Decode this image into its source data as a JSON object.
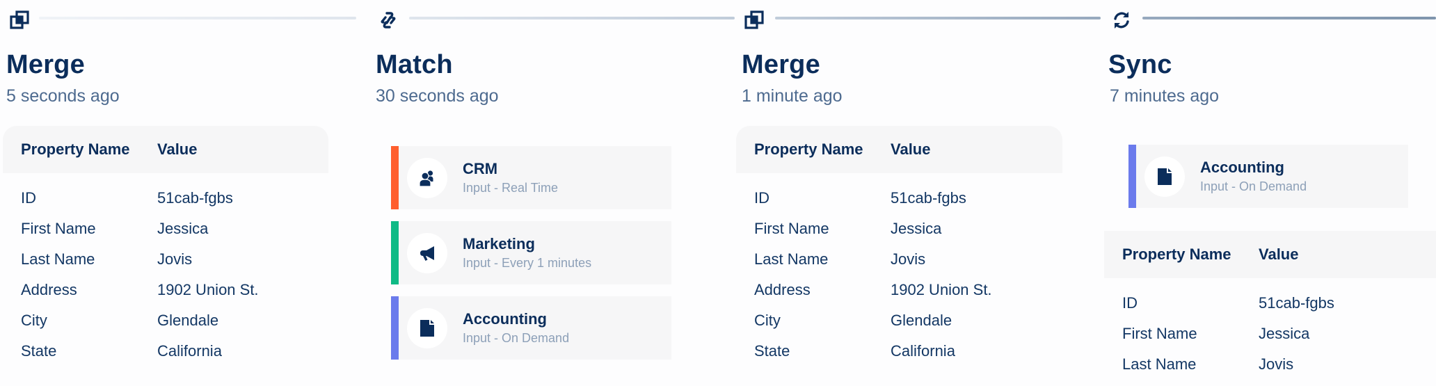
{
  "colors": {
    "primary": "#0b2d5b",
    "muted": "#4d6a8f",
    "crm": "#ff5f2e",
    "marketing": "#0fba85",
    "accounting": "#6b7bec"
  },
  "steps": [
    {
      "icon": "merge-icon",
      "title": "Merge",
      "time": "5 seconds ago",
      "table": {
        "headers": [
          "Property Name",
          "Value"
        ],
        "rows": [
          [
            "ID",
            "51cab-fgbs"
          ],
          [
            "First Name",
            "Jessica"
          ],
          [
            "Last Name",
            "Jovis"
          ],
          [
            "Address",
            "1902 Union St."
          ],
          [
            "City",
            "Glendale"
          ],
          [
            "State",
            "California"
          ]
        ]
      }
    },
    {
      "icon": "match-link-icon",
      "title": "Match",
      "time": "30 seconds ago",
      "sources": [
        {
          "icon": "users-icon",
          "name": "CRM",
          "mode": "Input - Real Time",
          "color": "#ff5f2e"
        },
        {
          "icon": "megaphone-icon",
          "name": "Marketing",
          "mode": "Input - Every 1 minutes",
          "color": "#0fba85"
        },
        {
          "icon": "document-icon",
          "name": "Accounting",
          "mode": "Input - On Demand",
          "color": "#6b7bec"
        }
      ]
    },
    {
      "icon": "merge-icon",
      "title": "Merge",
      "time": "1 minute ago",
      "table": {
        "headers": [
          "Property Name",
          "Value"
        ],
        "rows": [
          [
            "ID",
            "51cab-fgbs"
          ],
          [
            "First Name",
            "Jessica"
          ],
          [
            "Last Name",
            "Jovis"
          ],
          [
            "Address",
            "1902 Union St."
          ],
          [
            "City",
            "Glendale"
          ],
          [
            "State",
            "California"
          ]
        ]
      }
    },
    {
      "icon": "sync-icon",
      "title": "Sync",
      "time": "7 minutes ago",
      "sources": [
        {
          "icon": "document-icon",
          "name": "Accounting",
          "mode": "Input - On Demand",
          "color": "#6b7bec"
        }
      ],
      "table": {
        "headers": [
          "Property Name",
          "Value"
        ],
        "rows": [
          [
            "ID",
            "51cab-fgbs"
          ],
          [
            "First Name",
            "Jessica"
          ],
          [
            "Last Name",
            "Jovis"
          ]
        ]
      }
    }
  ]
}
